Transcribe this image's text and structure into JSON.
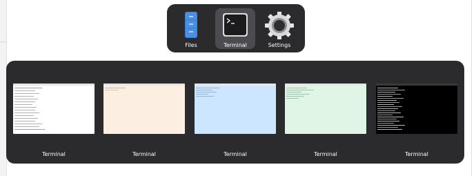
{
  "dock": {
    "apps": [
      {
        "label": "Files",
        "icon": "files-icon",
        "active": false
      },
      {
        "label": "Terminal",
        "icon": "terminal-icon",
        "active": true
      },
      {
        "label": "Settings",
        "icon": "settings-gear-icon",
        "active": false
      }
    ]
  },
  "windows": {
    "items": [
      {
        "label": "Terminal",
        "background": "#ffffff"
      },
      {
        "label": "Terminal",
        "background": "#fdeee2"
      },
      {
        "label": "Terminal",
        "background": "#cde6ff"
      },
      {
        "label": "Terminal",
        "background": "#e1f5e6"
      },
      {
        "label": "Terminal",
        "background": "#000000"
      }
    ]
  },
  "colors": {
    "panel": "#2b2b2e",
    "active_app": "#4c4c50",
    "files_blue": "#3584e4"
  }
}
